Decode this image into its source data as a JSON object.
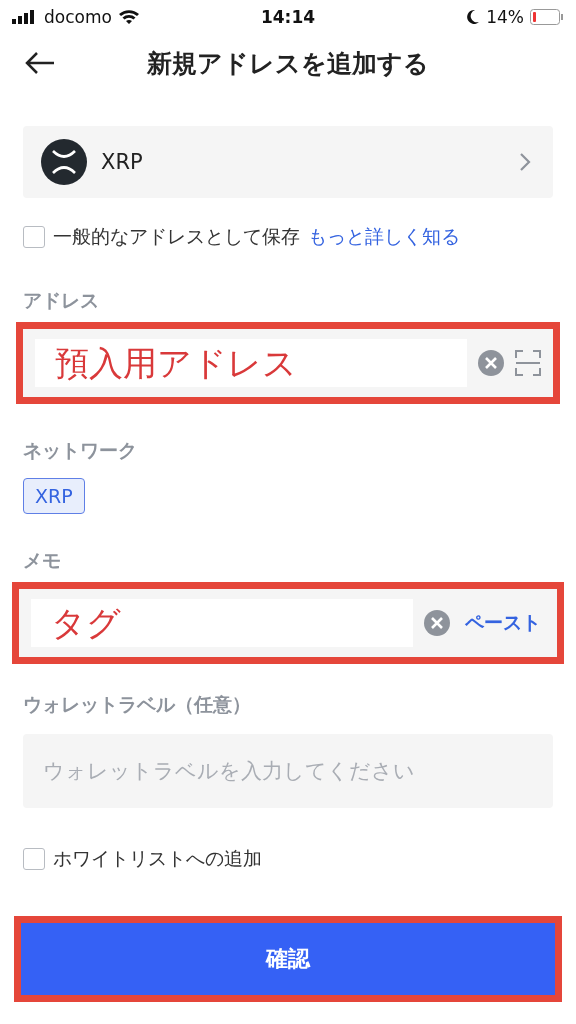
{
  "status_bar": {
    "carrier": "docomo",
    "time": "14:14",
    "battery": "14%"
  },
  "header": {
    "title": "新規アドレスを追加する"
  },
  "asset": {
    "name": "XRP"
  },
  "save_general": {
    "label": "一般的なアドレスとして保存",
    "link": "もっと詳しく知る",
    "checked": false
  },
  "address": {
    "label": "アドレス",
    "value": "預入用アドレス",
    "highlighted": true
  },
  "network": {
    "label": "ネットワーク",
    "chips": [
      {
        "label": "XRP",
        "selected": true
      }
    ]
  },
  "memo": {
    "label": "メモ",
    "value": "タグ",
    "action": "ペースト",
    "highlighted": true
  },
  "wallet_label": {
    "label": "ウォレットラベル（任意）",
    "placeholder": "ウォレットラベルを入力してください"
  },
  "whitelist": {
    "label": "ホワイトリストへの追加",
    "checked": false
  },
  "confirm": {
    "label": "確認",
    "highlighted": true
  }
}
